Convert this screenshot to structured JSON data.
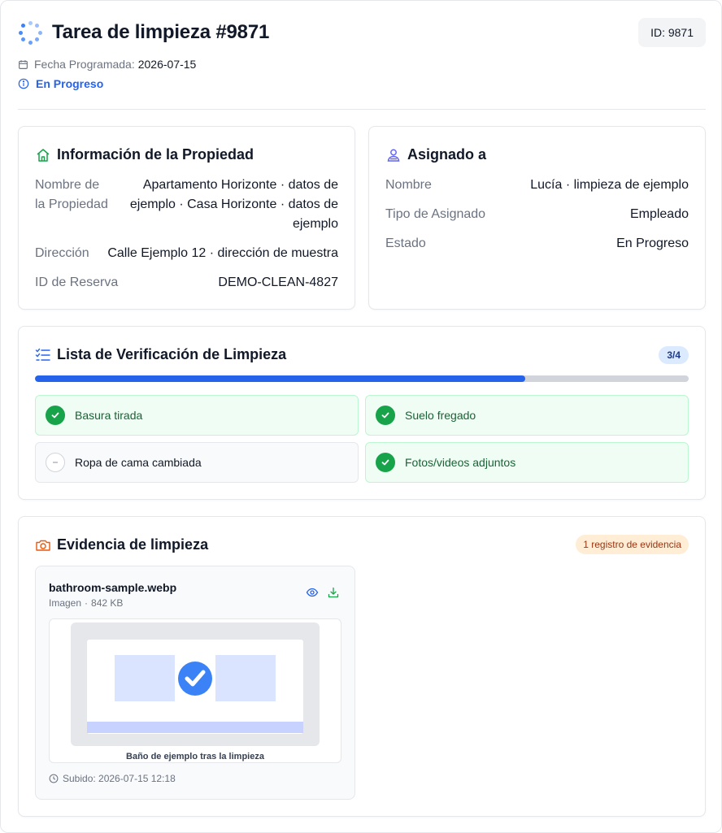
{
  "header": {
    "title": "Tarea de limpieza #9871",
    "id_badge": "ID: 9871",
    "date_label": "Fecha Programada:",
    "date_value": "2026-07-15",
    "status": "En Progreso"
  },
  "property": {
    "title": "Información de la Propiedad",
    "rows": [
      {
        "key": "Nombre de la Propiedad",
        "value": "Apartamento Horizonte · datos de ejemplo · Casa Horizonte · datos de ejemplo"
      },
      {
        "key": "Dirección",
        "value": "Calle Ejemplo 12 · dirección de muestra"
      },
      {
        "key": "ID de Reserva",
        "value": "DEMO-CLEAN-4827"
      }
    ]
  },
  "assigned": {
    "title": "Asignado a",
    "rows": [
      {
        "key": "Nombre",
        "value": "Lucía · limpieza de ejemplo"
      },
      {
        "key": "Tipo de Asignado",
        "value": "Empleado"
      },
      {
        "key": "Estado",
        "value": "En Progreso"
      }
    ]
  },
  "checklist": {
    "title": "Lista de Verificación de Limpieza",
    "count": "3/4",
    "progress": 0.75,
    "items": [
      {
        "label": "Basura tirada",
        "done": true
      },
      {
        "label": "Suelo fregado",
        "done": true
      },
      {
        "label": "Ropa de cama cambiada",
        "done": false
      },
      {
        "label": "Fotos/videos adjuntos",
        "done": true
      }
    ]
  },
  "evidence": {
    "title": "Evidencia de limpieza",
    "badge": "1 registro de evidencia",
    "file": {
      "name": "bathroom-sample.webp",
      "type": "Imagen",
      "size": "842 KB",
      "caption": "Baño de ejemplo tras la limpieza",
      "uploaded": "Subido: 2026-07-15 12:18"
    }
  },
  "colors": {
    "accent": "#2563eb",
    "success": "#16a34a",
    "warning_bg": "#ffedd5"
  },
  "icons": {
    "header": "spinner-icon",
    "date": "calendar-icon",
    "status": "info-icon",
    "property": "home-icon",
    "assigned": "user-icon",
    "checklist": "checklist-icon",
    "evidence": "camera-icon",
    "view": "eye-icon",
    "download": "download-icon",
    "uploaded": "clock-icon"
  }
}
